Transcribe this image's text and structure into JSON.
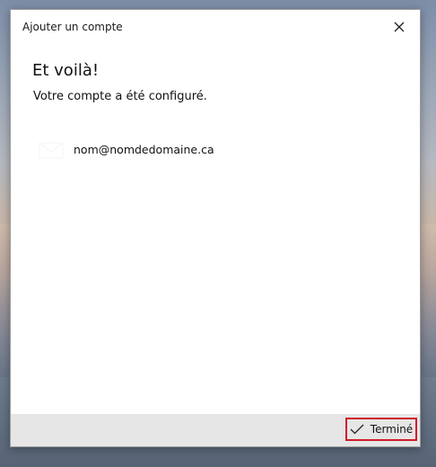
{
  "window": {
    "title": "Ajouter un compte"
  },
  "content": {
    "heading": "Et voilà!",
    "subtext": "Votre compte a été configuré.",
    "account": {
      "email": "nom@nomdedomaine.ca",
      "icon": "mail-account-icon"
    }
  },
  "footer": {
    "done_label": "Terminé",
    "done_icon": "checkmark-icon"
  },
  "colors": {
    "highlight": "#d11a2a",
    "footer_bg": "#e6e6e6",
    "dialog_bg": "#ffffff"
  }
}
